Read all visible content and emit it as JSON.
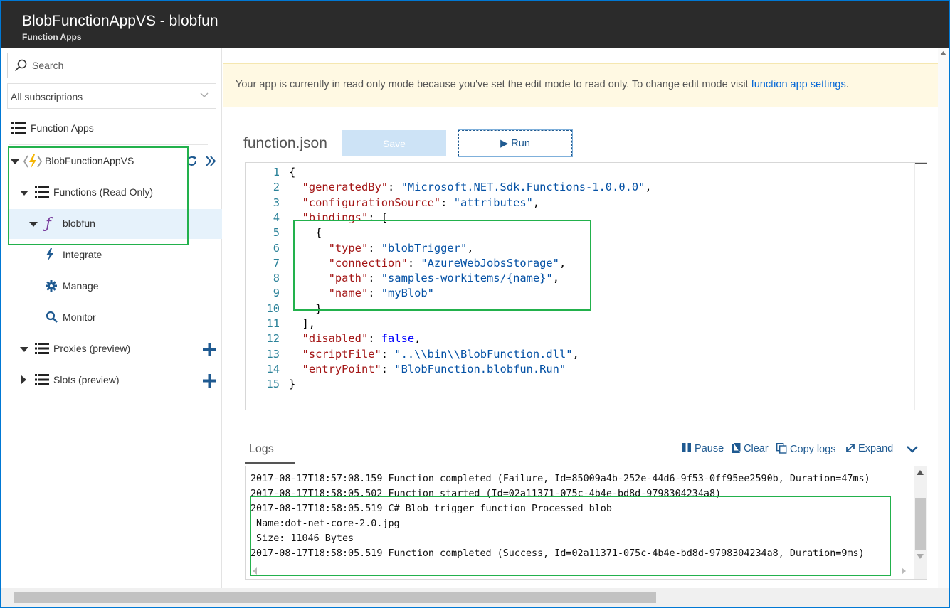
{
  "header": {
    "title": "BlobFunctionAppVS - blobfun",
    "subtitle": "Function Apps"
  },
  "sidebar": {
    "search_placeholder": "Search",
    "subscription_filter": "All subscriptions",
    "items": [
      {
        "label": "Function Apps"
      },
      {
        "label": "BlobFunctionAppVS"
      },
      {
        "label": "Functions (Read Only)"
      },
      {
        "label": "blobfun"
      },
      {
        "label": "Integrate"
      },
      {
        "label": "Manage"
      },
      {
        "label": "Monitor"
      },
      {
        "label": "Proxies (preview)"
      },
      {
        "label": "Slots (preview)"
      }
    ]
  },
  "banner": {
    "message": "Your app is currently in read only mode because you've set the edit mode to read only. To change edit mode visit ",
    "link": "function app settings",
    "suffix": "."
  },
  "editor": {
    "file_title": "function.json",
    "save_label": "Save",
    "run_label": "Run",
    "line_numbers": [
      "1",
      "2",
      "3",
      "4",
      "5",
      "6",
      "7",
      "8",
      "9",
      "10",
      "11",
      "12",
      "13",
      "14",
      "15"
    ],
    "keys": {
      "generatedBy": "\"generatedBy\"",
      "configurationSource": "\"configurationSource\"",
      "bindings": "\"bindings\"",
      "type": "\"type\"",
      "connection": "\"connection\"",
      "path": "\"path\"",
      "name": "\"name\"",
      "disabled": "\"disabled\"",
      "scriptFile": "\"scriptFile\"",
      "entryPoint": "\"entryPoint\""
    },
    "values": {
      "generatedBy": "\"Microsoft.NET.Sdk.Functions-1.0.0.0\"",
      "configurationSource": "\"attributes\"",
      "type": "\"blobTrigger\"",
      "connection": "\"AzureWebJobsStorage\"",
      "path": "\"samples-workitems/{name}\"",
      "name": "\"myBlob\"",
      "disabled": "false",
      "scriptFile": "\"..\\\\bin\\\\BlobFunction.dll\"",
      "entryPoint": "\"BlobFunction.blobfun.Run\""
    }
  },
  "logs": {
    "tab_label": "Logs",
    "pause_label": "Pause",
    "clear_label": "Clear",
    "copy_label": "Copy logs",
    "expand_label": "Expand",
    "lines": [
      "2017-08-17T18:57:08.159 Function completed (Failure, Id=85009a4b-252e-44d6-9f53-0ff95ee2590b, Duration=47ms)",
      "2017-08-17T18:58:05.502 Function started (Id=02a11371-075c-4b4e-bd8d-9798304234a8)",
      "2017-08-17T18:58:05.519 C# Blob trigger function Processed blob",
      " Name:dot-net-core-2.0.jpg",
      " Size: 11046 Bytes",
      "2017-08-17T18:58:05.519 Function completed (Success, Id=02a11371-075c-4b4e-bd8d-9798304234a8, Duration=9ms)"
    ]
  },
  "colors": {
    "accent": "#0366d6",
    "highlight_box": "#22b14c",
    "header_bg": "#2b2b2b"
  }
}
